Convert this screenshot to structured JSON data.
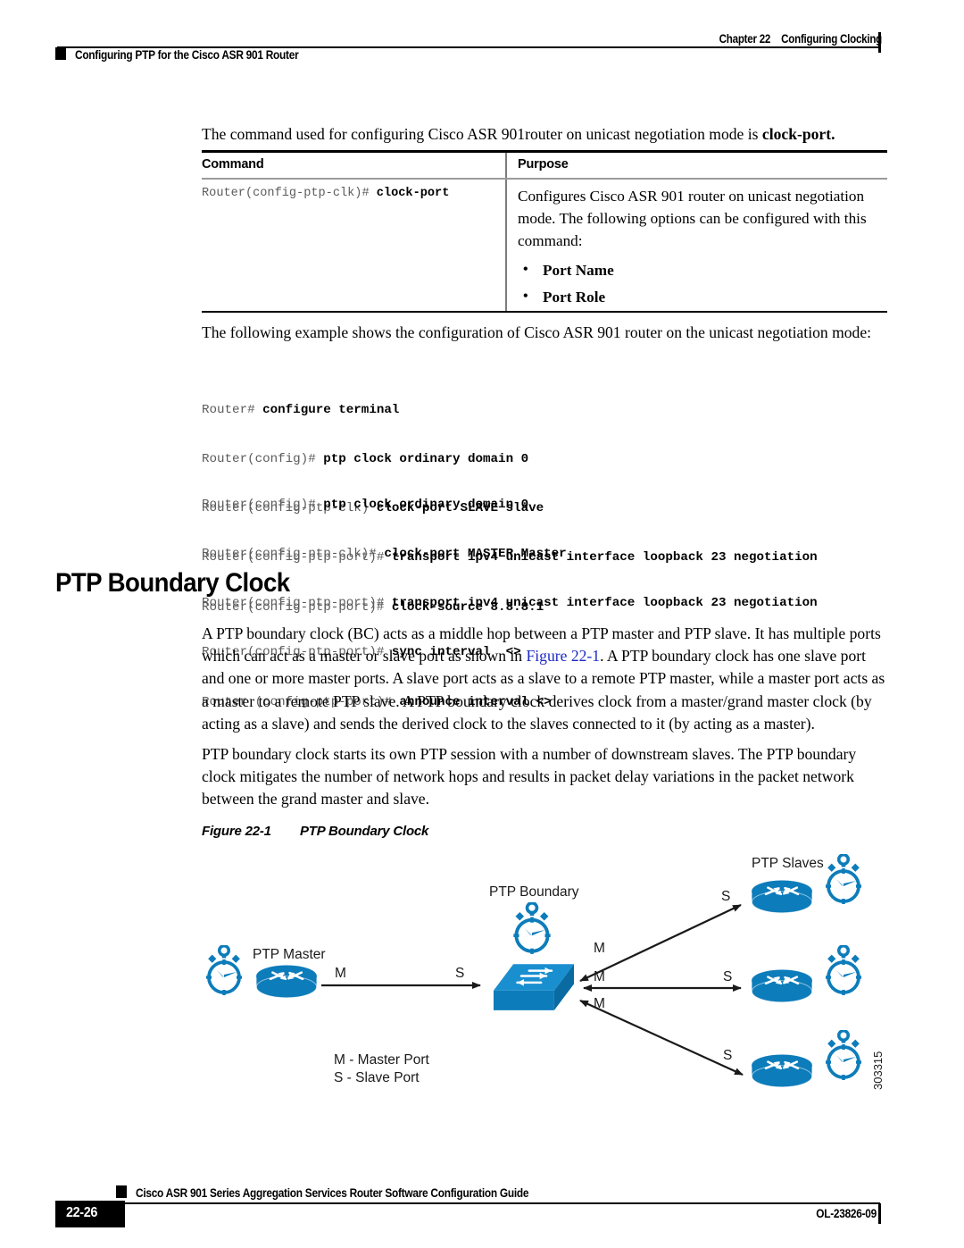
{
  "header": {
    "chapter": "Chapter 22",
    "chapter_title": "Configuring Clocking",
    "running_title": "Configuring PTP for the Cisco ASR 901 Router"
  },
  "intro": {
    "lead_text": "The command used for configuring Cisco ASR 901router on unicast negotiation mode is ",
    "lead_bold": "clock-port."
  },
  "command_table": {
    "columns": [
      "Command",
      "Purpose"
    ],
    "rows": [
      {
        "command_prompt": "Router(config-ptp-clk)# ",
        "command_bold": "clock-port",
        "purpose": "Configures Cisco ASR 901 router on unicast negotiation mode. The following options can be configured with this command:",
        "options": [
          "Port Name",
          "Port Role"
        ]
      }
    ]
  },
  "example": {
    "intro": "The following example shows the configuration of Cisco ASR 901 router on the unicast negotiation mode:",
    "block1": [
      {
        "prompt": "Router# ",
        "command": "configure terminal"
      },
      {
        "prompt": "Router(config)# ",
        "command": "ptp clock ordinary domain 0"
      },
      {
        "prompt": "Router(config-ptp-clk) ",
        "command": "clock-port SLAVE slave"
      },
      {
        "prompt": "Router(config-ptp-port)# ",
        "command": "transport ipv4 unicast interface loopback 23 negotiation"
      },
      {
        "prompt": "Router(config-ptp-port)# ",
        "command": "clock-source 8.8.8.1"
      }
    ],
    "block2": [
      {
        "prompt": "Router(config)# ",
        "command": "ptp clock ordinary domain 0"
      },
      {
        "prompt": "Router(config-ptp-clk)# ",
        "command": "clock-port MASTER Master"
      },
      {
        "prompt": "Router(config-ptp-port)# ",
        "command": "transport ipv4 unicast interface loopback 23 negotiation"
      },
      {
        "prompt": "Router(config-ptp-port)# ",
        "command": "sync interval  <>"
      },
      {
        "prompt": "Router (config-ptp-port)# ",
        "command": "announce interval <>"
      }
    ]
  },
  "section": {
    "heading": "PTP Boundary Clock",
    "paragraph1_a": "A PTP boundary clock (BC) acts as a middle hop between a PTP master and PTP slave. It has multiple ports which can act as a master or slave port as shown in ",
    "paragraph1_link": "Figure 22-1",
    "paragraph1_b": ". A PTP boundary clock has one slave port and one or more master ports. A slave port acts as a slave to a remote PTP master, while a master port acts as a master to a remote PTP slave. A PTP boundary clock derives clock from a master/grand master clock (by acting as a slave) and sends the derived clock to the slaves connected to it (by acting as a master).",
    "paragraph2": "PTP boundary clock starts its own PTP session with a number of downstream slaves. The PTP boundary clock mitigates the number of network hops and results in packet delay variations in the packet network between the grand master and slave."
  },
  "figure": {
    "caption_number": "Figure 22-1",
    "caption_title": "PTP Boundary Clock",
    "artwork_id": "303315",
    "accent_color": "#0d7cba",
    "labels": {
      "master": "PTP Master",
      "boundary": "PTP Boundary",
      "slaves": "PTP Slaves"
    },
    "port_labels": {
      "master_link_left": "M",
      "master_link_right": "S",
      "boundary_top": "M",
      "boundary_mid": "M",
      "boundary_bottom": "M",
      "slave_top": "S",
      "slave_mid": "S",
      "slave_bottom": "S"
    },
    "legend": [
      "M - Master Port",
      "S - Slave Port"
    ]
  },
  "footer": {
    "guide_title": "Cisco ASR 901 Series Aggregation Services Router Software Configuration Guide",
    "page_number": "22-26",
    "doc_id": "OL-23826-09"
  }
}
